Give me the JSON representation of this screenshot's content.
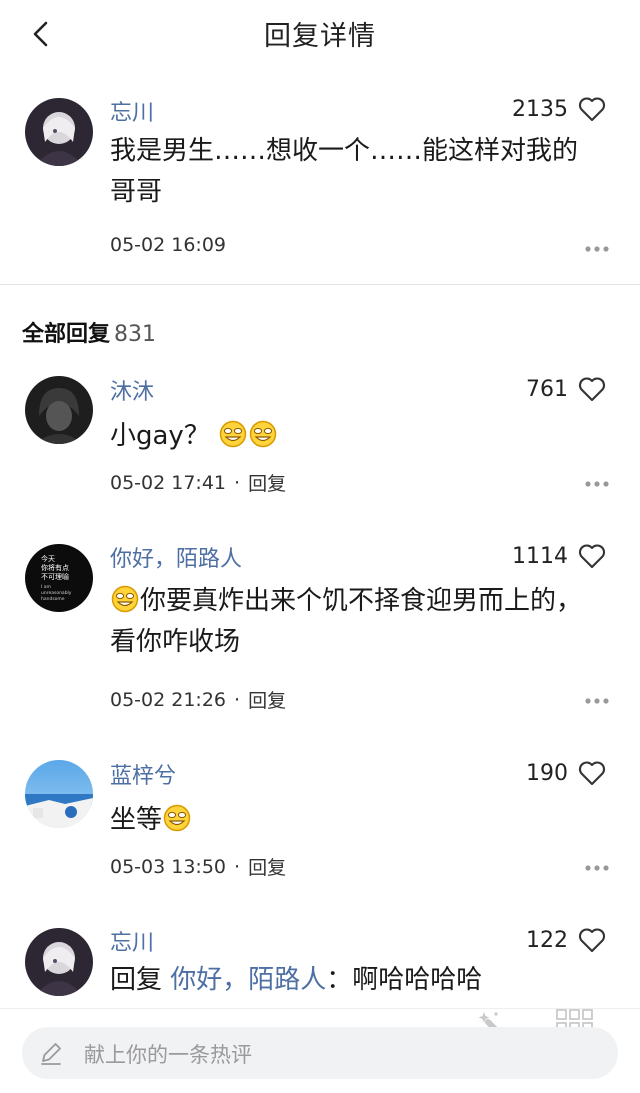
{
  "header": {
    "title": "回复详情"
  },
  "main_comment": {
    "username": "忘川",
    "likes": "2135",
    "text": "我是男生……想收一个……能这样对我的哥哥",
    "time": "05-02 16:09"
  },
  "replies_header": {
    "label": "全部回复",
    "count": "831"
  },
  "replies": [
    {
      "username": "沐沐",
      "likes": "761",
      "text": "小gay？",
      "time": "05-02 17:41",
      "reply_label": "回复"
    },
    {
      "username": "你好，陌路人",
      "likes": "1114",
      "text": "你要真炸出来个饥不择食迎男而上的，看你咋收场",
      "time": "05-02 21:26",
      "reply_label": "回复",
      "avatar_text": [
        "今天",
        "你将有点",
        "不可理喻",
        "I am",
        "unreasonably",
        "handsome"
      ]
    },
    {
      "username": "蓝梓兮",
      "likes": "190",
      "text": "坐等",
      "time": "05-03 13:50",
      "reply_label": "回复"
    },
    {
      "username": "忘川",
      "likes": "122",
      "reply_prefix": "回复",
      "reply_to": "你好，陌路人",
      "text": "：啊哈哈哈哈"
    }
  ],
  "separator": "·",
  "bottom": {
    "placeholder": "献上你的一条热评"
  },
  "icons": [
    "back-arrow-icon",
    "heart-icon",
    "more-dots-icon",
    "grin-emoji-icon",
    "pencil-icon",
    "magic-wand-icon",
    "grid-icon"
  ],
  "colors": {
    "username": "#4d6fa3",
    "text": "#1a1a1a",
    "meta": "#333333",
    "placeholder": "#9a9a9a",
    "input_bg": "#f1f2f4"
  }
}
